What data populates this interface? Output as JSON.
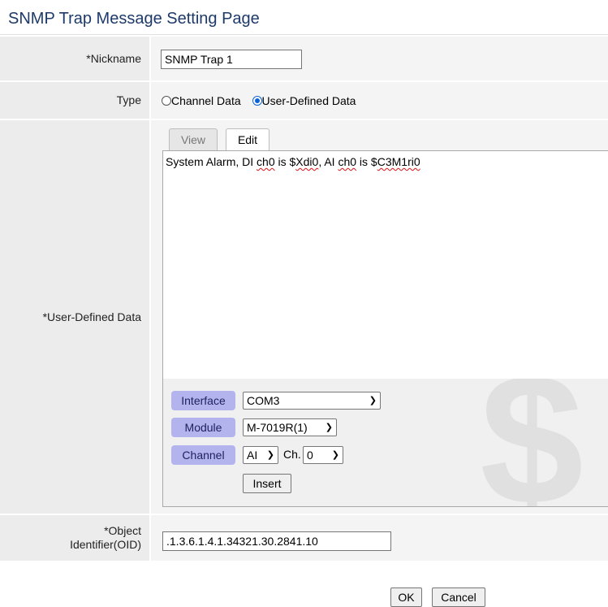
{
  "page": {
    "title": "SNMP Trap Message Setting Page"
  },
  "nickname": {
    "label": "*Nickname",
    "value": "SNMP Trap 1"
  },
  "type": {
    "label": "Type",
    "options": [
      {
        "label": "Channel Data",
        "selected": false
      },
      {
        "label": "User-Defined Data",
        "selected": true
      }
    ]
  },
  "user_defined": {
    "label": "*User-Defined Data",
    "tabs": {
      "view": "View",
      "edit": "Edit",
      "active": "Edit"
    },
    "editor": {
      "p1": "System Alarm, DI ",
      "w1": "ch0",
      "p2": " is $",
      "w2": "Xdi0",
      "p3": ", AI ",
      "w3": "ch0",
      "p4": " is $",
      "w4": "C3M1ri0"
    },
    "watermark": "$",
    "interface": {
      "label": "Interface",
      "value": "COM3"
    },
    "module": {
      "label": "Module",
      "value": "M-7019R(1)"
    },
    "channel": {
      "label": "Channel",
      "type_value": "AI",
      "ch_label": "Ch.",
      "ch_value": "0"
    },
    "insert_label": "Insert"
  },
  "oid": {
    "label_line1": "*Object",
    "label_line2": "Identifier(OID)",
    "value": ".1.3.6.1.4.1.34321.30.2841.10"
  },
  "footer": {
    "ok_label": "OK",
    "cancel_label": "Cancel"
  },
  "colors": {
    "title": "#1d3a6a",
    "pill": "#b3b4ee",
    "accent": "#0a62d6"
  }
}
